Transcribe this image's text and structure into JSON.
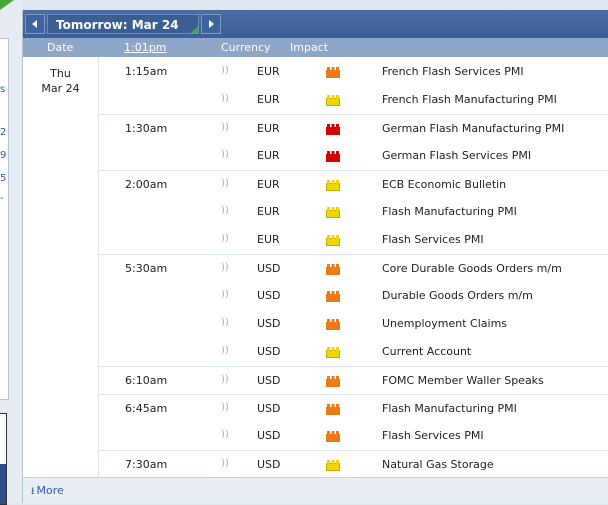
{
  "left_panel": {
    "fragments": [
      "s",
      "2",
      "9",
      "5",
      "-"
    ]
  },
  "nav": {
    "date_label": "Tomorrow: Mar 24",
    "prev_icon": "caret-left-icon",
    "next_icon": "caret-right-icon"
  },
  "columns": {
    "date": "Date",
    "time": "1:01pm",
    "currency": "Currency",
    "impact": "Impact"
  },
  "day": {
    "weekday": "Thu",
    "date": "Mar 24"
  },
  "impact_colors": {
    "high": "#d60000",
    "medium": "#ec7a16",
    "low": "#f2d500"
  },
  "events": [
    {
      "time": "1:15am",
      "currency": "EUR",
      "impact": "medium",
      "name": "French Flash Services PMI"
    },
    {
      "time": "",
      "currency": "EUR",
      "impact": "low",
      "name": "French Flash Manufacturing PMI"
    },
    {
      "time": "1:30am",
      "currency": "EUR",
      "impact": "high",
      "name": "German Flash Manufacturing PMI"
    },
    {
      "time": "",
      "currency": "EUR",
      "impact": "high",
      "name": "German Flash Services PMI"
    },
    {
      "time": "2:00am",
      "currency": "EUR",
      "impact": "low",
      "name": "ECB Economic Bulletin"
    },
    {
      "time": "",
      "currency": "EUR",
      "impact": "low",
      "name": "Flash Manufacturing PMI"
    },
    {
      "time": "",
      "currency": "EUR",
      "impact": "low",
      "name": "Flash Services PMI"
    },
    {
      "time": "5:30am",
      "currency": "USD",
      "impact": "medium",
      "name": "Core Durable Goods Orders m/m"
    },
    {
      "time": "",
      "currency": "USD",
      "impact": "medium",
      "name": "Durable Goods Orders m/m"
    },
    {
      "time": "",
      "currency": "USD",
      "impact": "medium",
      "name": "Unemployment Claims"
    },
    {
      "time": "",
      "currency": "USD",
      "impact": "low",
      "name": "Current Account"
    },
    {
      "time": "6:10am",
      "currency": "USD",
      "impact": "medium",
      "name": "FOMC Member Waller Speaks"
    },
    {
      "time": "6:45am",
      "currency": "USD",
      "impact": "medium",
      "name": "Flash Manufacturing PMI"
    },
    {
      "time": "",
      "currency": "USD",
      "impact": "medium",
      "name": "Flash Services PMI"
    },
    {
      "time": "7:30am",
      "currency": "USD",
      "impact": "low",
      "name": "Natural Gas Storage"
    }
  ],
  "footer": {
    "more_label": "More",
    "more_icon": "download-arrow-icon"
  }
}
